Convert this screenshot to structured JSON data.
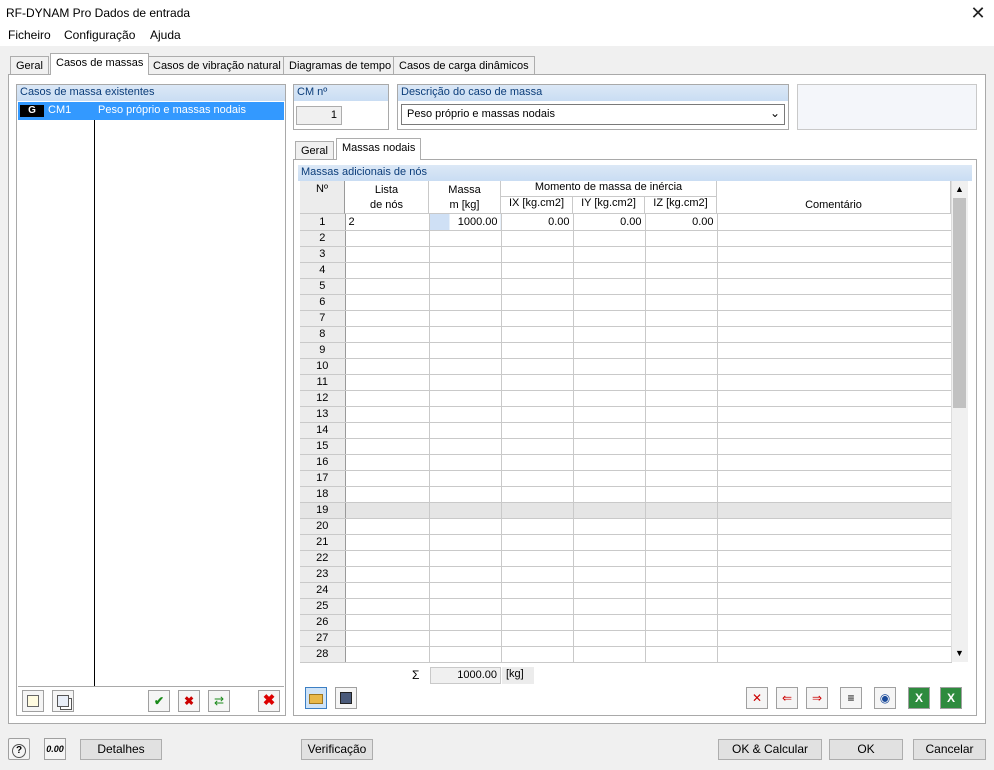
{
  "window": {
    "title": "RF-DYNAM Pro Dados de entrada",
    "close_glyph": "✕"
  },
  "menu": [
    "Ficheiro",
    "Configuração",
    "Ajuda"
  ],
  "tabs": [
    "Geral",
    "Casos de massas",
    "Casos de vibração natural",
    "Diagramas de tempo",
    "Casos de carga dinâmicos"
  ],
  "existing": {
    "header": "Casos de massa existentes",
    "items": [
      {
        "tag": "G",
        "id": "CM1",
        "name": "Peso próprio e massas nodais"
      }
    ]
  },
  "cm": {
    "label": "CM nº",
    "value": "1"
  },
  "description": {
    "label": "Descrição do caso de massa",
    "value": "Peso próprio e massas nodais"
  },
  "subtabs": [
    "Geral",
    "Massas nodais"
  ],
  "table": {
    "title": "Massas adicionais de nós",
    "headers": {
      "no": "Nº",
      "lista1": "Lista",
      "lista2": "de nós",
      "massa1": "Massa",
      "massa2": "m [kg]",
      "momento": "Momento de massa de inércia",
      "ix": "IX [kg.cm2]",
      "iy": "IY [kg.cm2]",
      "iz": "IZ [kg.cm2]",
      "comentario": "Comentário"
    },
    "rows": [
      {
        "n": "1",
        "lista": "2",
        "massa": "1000.00",
        "ix": "0.00",
        "iy": "0.00",
        "iz": "0.00",
        "comment": ""
      },
      {
        "n": "2"
      },
      {
        "n": "3"
      },
      {
        "n": "4"
      },
      {
        "n": "5"
      },
      {
        "n": "6"
      },
      {
        "n": "7"
      },
      {
        "n": "8"
      },
      {
        "n": "9"
      },
      {
        "n": "10"
      },
      {
        "n": "11"
      },
      {
        "n": "12"
      },
      {
        "n": "13"
      },
      {
        "n": "14"
      },
      {
        "n": "15"
      },
      {
        "n": "16"
      },
      {
        "n": "17"
      },
      {
        "n": "18"
      },
      {
        "n": "19"
      },
      {
        "n": "20"
      },
      {
        "n": "21"
      },
      {
        "n": "22"
      },
      {
        "n": "23"
      },
      {
        "n": "24"
      },
      {
        "n": "25"
      },
      {
        "n": "26"
      },
      {
        "n": "27"
      },
      {
        "n": "28"
      }
    ],
    "sum_symbol": "Σ",
    "sum_value": "1000.00",
    "sum_unit": "[kg]"
  },
  "icons": {
    "left_panel": [
      "new-case-icon",
      "copy-case-icon",
      "select-all-icon",
      "deselect-icon",
      "renumber-icon",
      "delete-case-icon"
    ],
    "table_bottom_left": [
      "open-folder-icon",
      "save-icon"
    ],
    "table_bottom_right": [
      "delete-rows-icon",
      "insert-row-icon",
      "remove-row-icon",
      "sort-icon",
      "view-icon",
      "export-excel-icon",
      "import-excel-icon"
    ]
  },
  "bottom": {
    "help_glyph": "?",
    "units_glyph": "0.00",
    "detalhes": "Detalhes",
    "verificacao": "Verificação",
    "ok_calc": "OK & Calcular",
    "ok": "OK",
    "cancel": "Cancelar"
  },
  "colors": {
    "selection": "#3399ff",
    "header_blue": "#dce8f6",
    "highlight_row": "#e5e5e5"
  }
}
